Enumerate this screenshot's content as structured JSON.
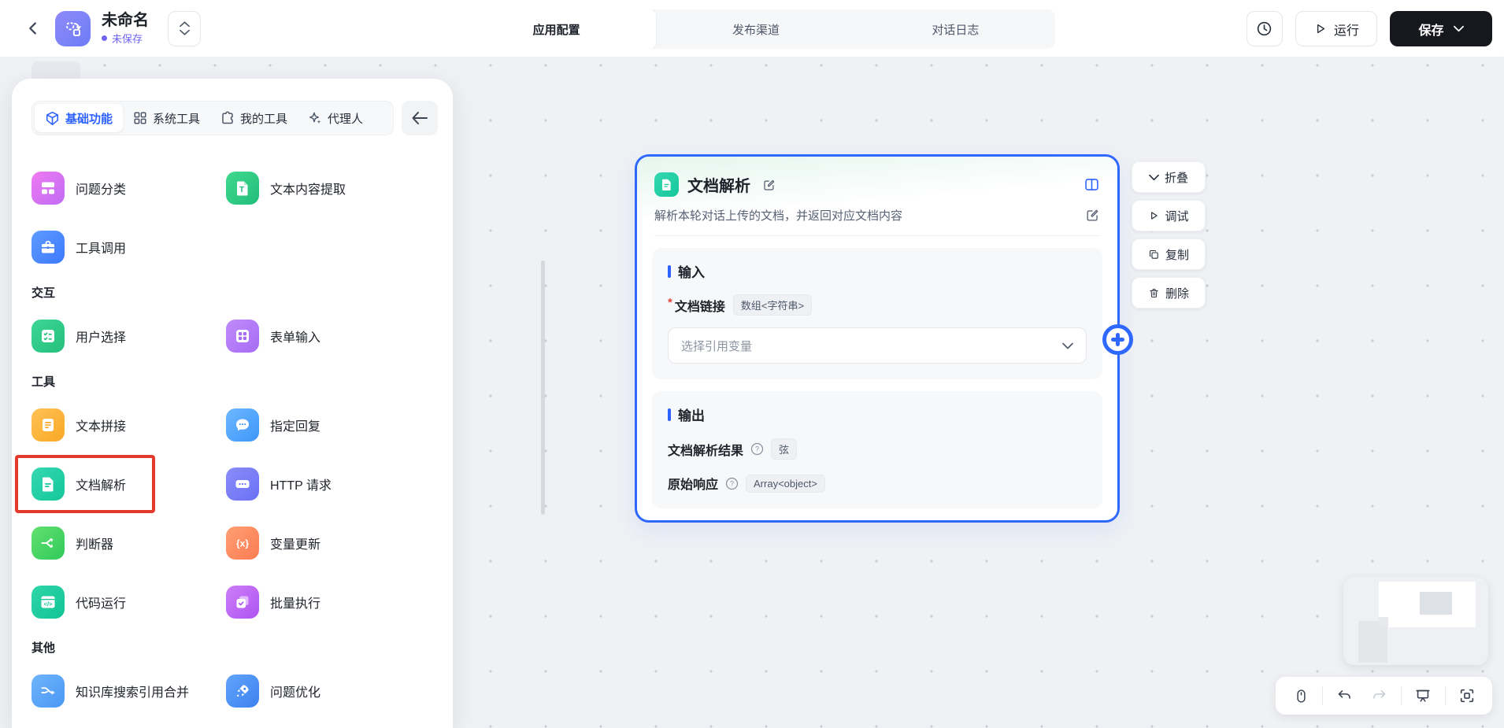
{
  "colors": {
    "accent_blue": "#2e62fe",
    "node_border": "#2f68ff",
    "unsaved_purple": "#6f63f2",
    "highlight_red": "#e43a2e",
    "save_button_bg": "#16181d"
  },
  "topbar": {
    "title": "未命名",
    "status": "未保存",
    "tabs": [
      {
        "label": "应用配置",
        "active": true
      },
      {
        "label": "发布渠道",
        "active": false
      },
      {
        "label": "对话日志",
        "active": false
      }
    ],
    "run_label": "运行",
    "save_label": "保存"
  },
  "panel": {
    "tabs": [
      {
        "label": "基础功能",
        "active": true
      },
      {
        "label": "系统工具",
        "active": false
      },
      {
        "label": "我的工具",
        "active": false
      },
      {
        "label": "代理人",
        "active": false
      }
    ],
    "section_headers": {
      "interaction": "交互",
      "tools": "工具",
      "others": "其他"
    },
    "items": [
      {
        "label": "问题分类",
        "icon": "category-icon"
      },
      {
        "label": "文本内容提取",
        "icon": "text-extract-icon"
      },
      {
        "label": "工具调用",
        "icon": "toolbox-icon"
      },
      {
        "label": "用户选择",
        "icon": "user-select-icon"
      },
      {
        "label": "表单输入",
        "icon": "form-input-icon"
      },
      {
        "label": "文本拼接",
        "icon": "text-concat-icon"
      },
      {
        "label": "指定回复",
        "icon": "reply-icon"
      },
      {
        "label": "文档解析",
        "icon": "doc-parse-icon",
        "highlighted": true
      },
      {
        "label": "HTTP 请求",
        "icon": "http-icon"
      },
      {
        "label": "判断器",
        "icon": "branch-icon"
      },
      {
        "label": "变量更新",
        "icon": "variable-icon"
      },
      {
        "label": "代码运行",
        "icon": "code-icon"
      },
      {
        "label": "批量执行",
        "icon": "batch-icon"
      },
      {
        "label": "知识库搜索引用合并",
        "icon": "kb-merge-icon"
      },
      {
        "label": "问题优化",
        "icon": "rocket-icon"
      }
    ]
  },
  "node": {
    "title": "文档解析",
    "description": "解析本轮对话上传的文档，并返回对应文档内容",
    "input": {
      "heading": "输入",
      "param_required": "*",
      "param_label": "文档链接",
      "param_type": "数组<字符串>",
      "select_placeholder": "选择引用变量"
    },
    "output": {
      "heading": "输出",
      "fields": [
        {
          "label": "文档解析结果",
          "type": "弦"
        },
        {
          "label": "原始响应",
          "type": "Array<object>"
        }
      ]
    }
  },
  "node_actions": [
    {
      "label": "折叠",
      "icon": "chevron-down-icon"
    },
    {
      "label": "调试",
      "icon": "play-icon"
    },
    {
      "label": "复制",
      "icon": "copy-icon"
    },
    {
      "label": "删除",
      "icon": "trash-icon"
    }
  ]
}
